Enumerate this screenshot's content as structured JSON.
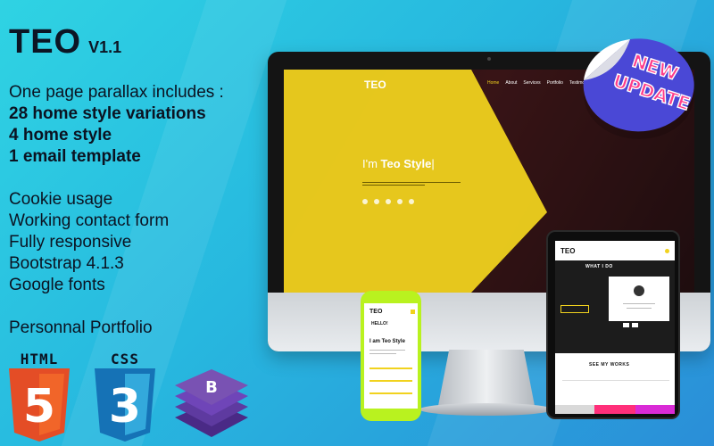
{
  "title": {
    "brand": "TEO",
    "version": "V1.1"
  },
  "features": {
    "intro": "One page parallax includes :",
    "bold_items": [
      "28 home style variations",
      "4 home style",
      "1 email template"
    ],
    "items": [
      "Cookie usage",
      "Working contact form",
      "Fully responsive",
      "Bootstrap 4.1.3",
      "Google fonts"
    ],
    "extra": "Personnal Portfolio"
  },
  "badges": {
    "html_label": "HTML",
    "html_number": "5",
    "css_label": "CSS",
    "css_number": "3",
    "bootstrap_letter": "B"
  },
  "sticker": {
    "line1": "NEW",
    "line2": "UPDATE"
  },
  "monitor_site": {
    "logo": "TEO",
    "nav": [
      "Home",
      "About",
      "Services",
      "Portfolio",
      "Testimo..."
    ],
    "hero_prefix": "I'm ",
    "hero_name": "Teo Style",
    "hero_cursor": "|"
  },
  "tablet_site": {
    "logo": "TEO",
    "section_heading": "WHAT I DO",
    "works_heading": "SEE MY WORKS"
  },
  "phone_site": {
    "logo": "TEO",
    "hello": "HELLO!",
    "hero": "I am Teo Style"
  },
  "colors": {
    "accent_yellow": "#f1d21e",
    "html_orange": "#e44d26",
    "css_blue": "#1572b6",
    "bootstrap_purple": "#7952b3",
    "sticker_purple": "#4a48d6"
  }
}
